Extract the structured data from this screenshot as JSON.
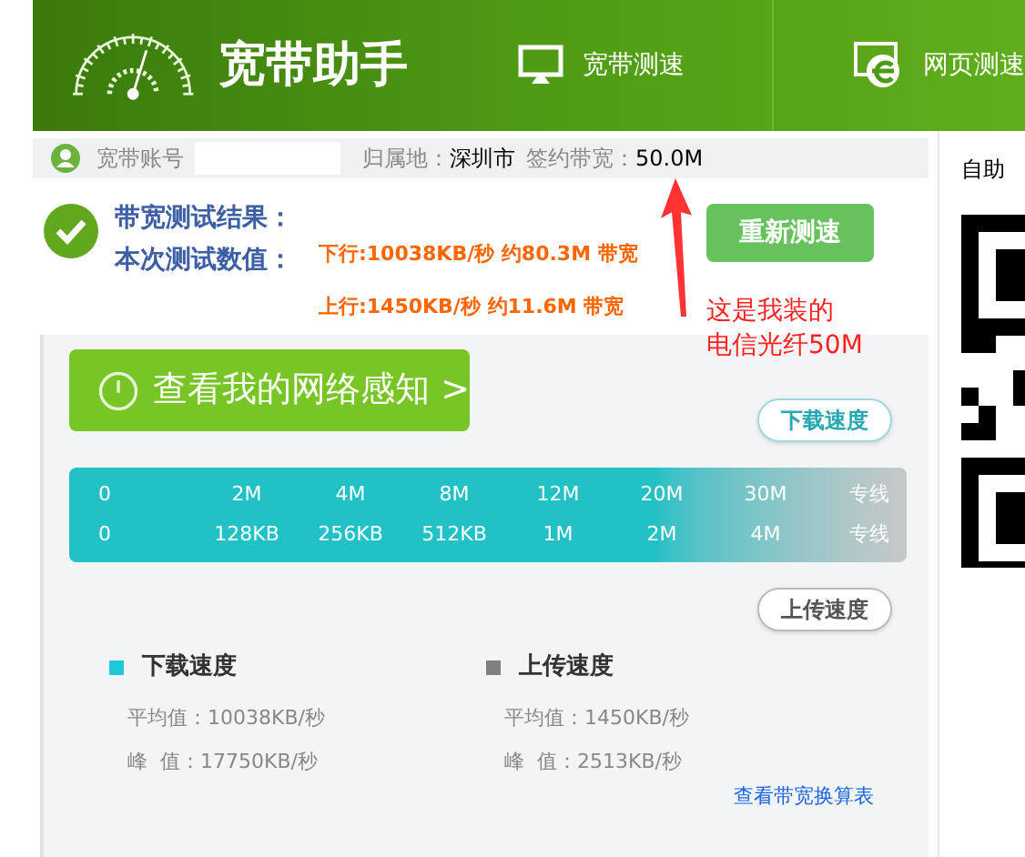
{
  "header": {
    "title": "宽带助手",
    "tabs": [
      {
        "kind": "monitor",
        "label": "宽带测速"
      },
      {
        "kind": "browser",
        "label": "网页测速"
      }
    ]
  },
  "account_bar": {
    "account_label": "宽带账号",
    "location_label": "归属地：",
    "location": "深圳市",
    "bandwidth_label": "签约带宽：",
    "bandwidth": "50.0M"
  },
  "result": {
    "title": "带宽测试结果：",
    "values_label": "本次测试数值：",
    "download": "下行:10038KB/秒 约80.3M 带宽",
    "upload": "上行:1450KB/秒 约11.6M 带宽",
    "retest_button": "重新测速"
  },
  "network_button": "查看我的网络感知 >",
  "scale": {
    "download_tag": "下载速度",
    "download_ticks": [
      "0",
      "2M",
      "4M",
      "8M",
      "12M",
      "20M",
      "30M",
      "专线"
    ],
    "upload_ticks": [
      "0",
      "128KB",
      "256KB",
      "512KB",
      "1M",
      "2M",
      "4M",
      "专线"
    ],
    "upload_tag": "上传速度"
  },
  "legend": [
    {
      "title": "下载速度",
      "color": "#1fc8d6",
      "average": "平均值：10038KB/秒",
      "peak": "峰  值：17750KB/秒"
    },
    {
      "title": "上传速度",
      "color": "#808080",
      "average": "平均值：1450KB/秒",
      "peak": "峰  值：2513KB/秒"
    }
  ],
  "link": "查看带宽换算表",
  "side_panel": {
    "title": "自助"
  },
  "annotation": {
    "lines": [
      "这是我装的",
      "电信光纤50M"
    ]
  }
}
